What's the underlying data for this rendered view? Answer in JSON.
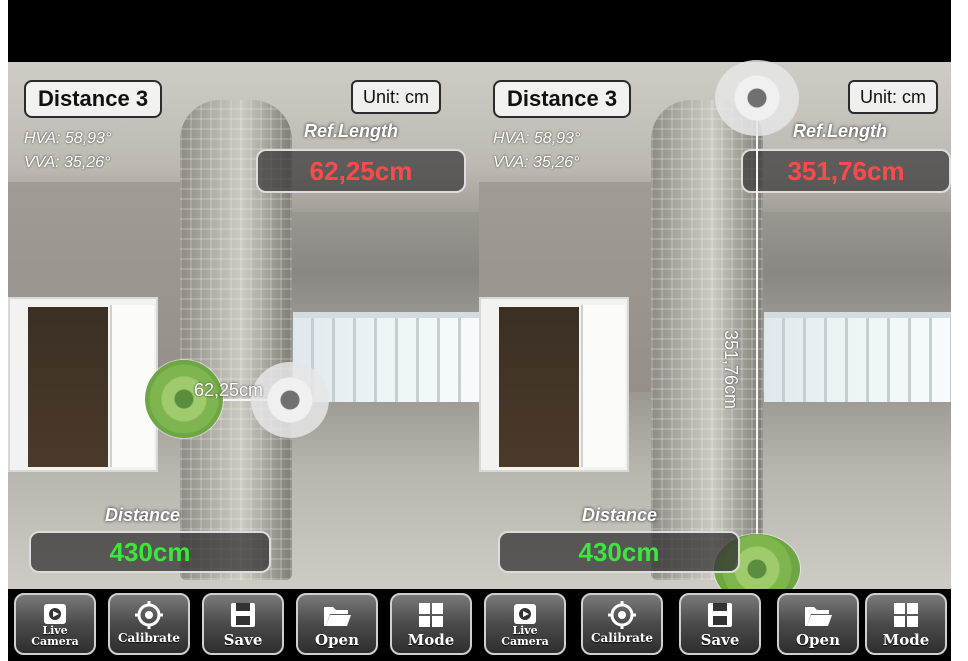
{
  "screens": [
    {
      "measurement_name": "Distance 3",
      "unit_label": "Unit: cm",
      "hva": "HVA: 58,93°",
      "vva": "VVA: 35,26°",
      "ref_length_label": "Ref.Length",
      "ref_length_value": "62,25cm",
      "measure_label": "62,25cm",
      "distance_label": "Distance",
      "distance_value": "430cm"
    },
    {
      "measurement_name": "Distance 3",
      "unit_label": "Unit: cm",
      "hva": "HVA: 58,93°",
      "vva": "VVA: 35,26°",
      "ref_length_label": "Ref.Length",
      "ref_length_value": "351,76cm",
      "measure_label": "351,76cm",
      "distance_label": "Distance",
      "distance_value": "430cm"
    }
  ],
  "toolbar": {
    "buttons": [
      {
        "label_line1": "Live",
        "label_line2": "Camera",
        "icon": "live-camera-icon"
      },
      {
        "label": "Calibrate",
        "icon": "calibrate-icon"
      },
      {
        "label": "Save",
        "icon": "save-icon"
      },
      {
        "label": "Open",
        "icon": "open-folder-icon"
      },
      {
        "label": "Mode",
        "icon": "mode-grid-icon"
      }
    ]
  },
  "colors": {
    "ref_value": "#ff4a4a",
    "distance_value": "#3de63d",
    "marker_green": "#7fb54f"
  }
}
